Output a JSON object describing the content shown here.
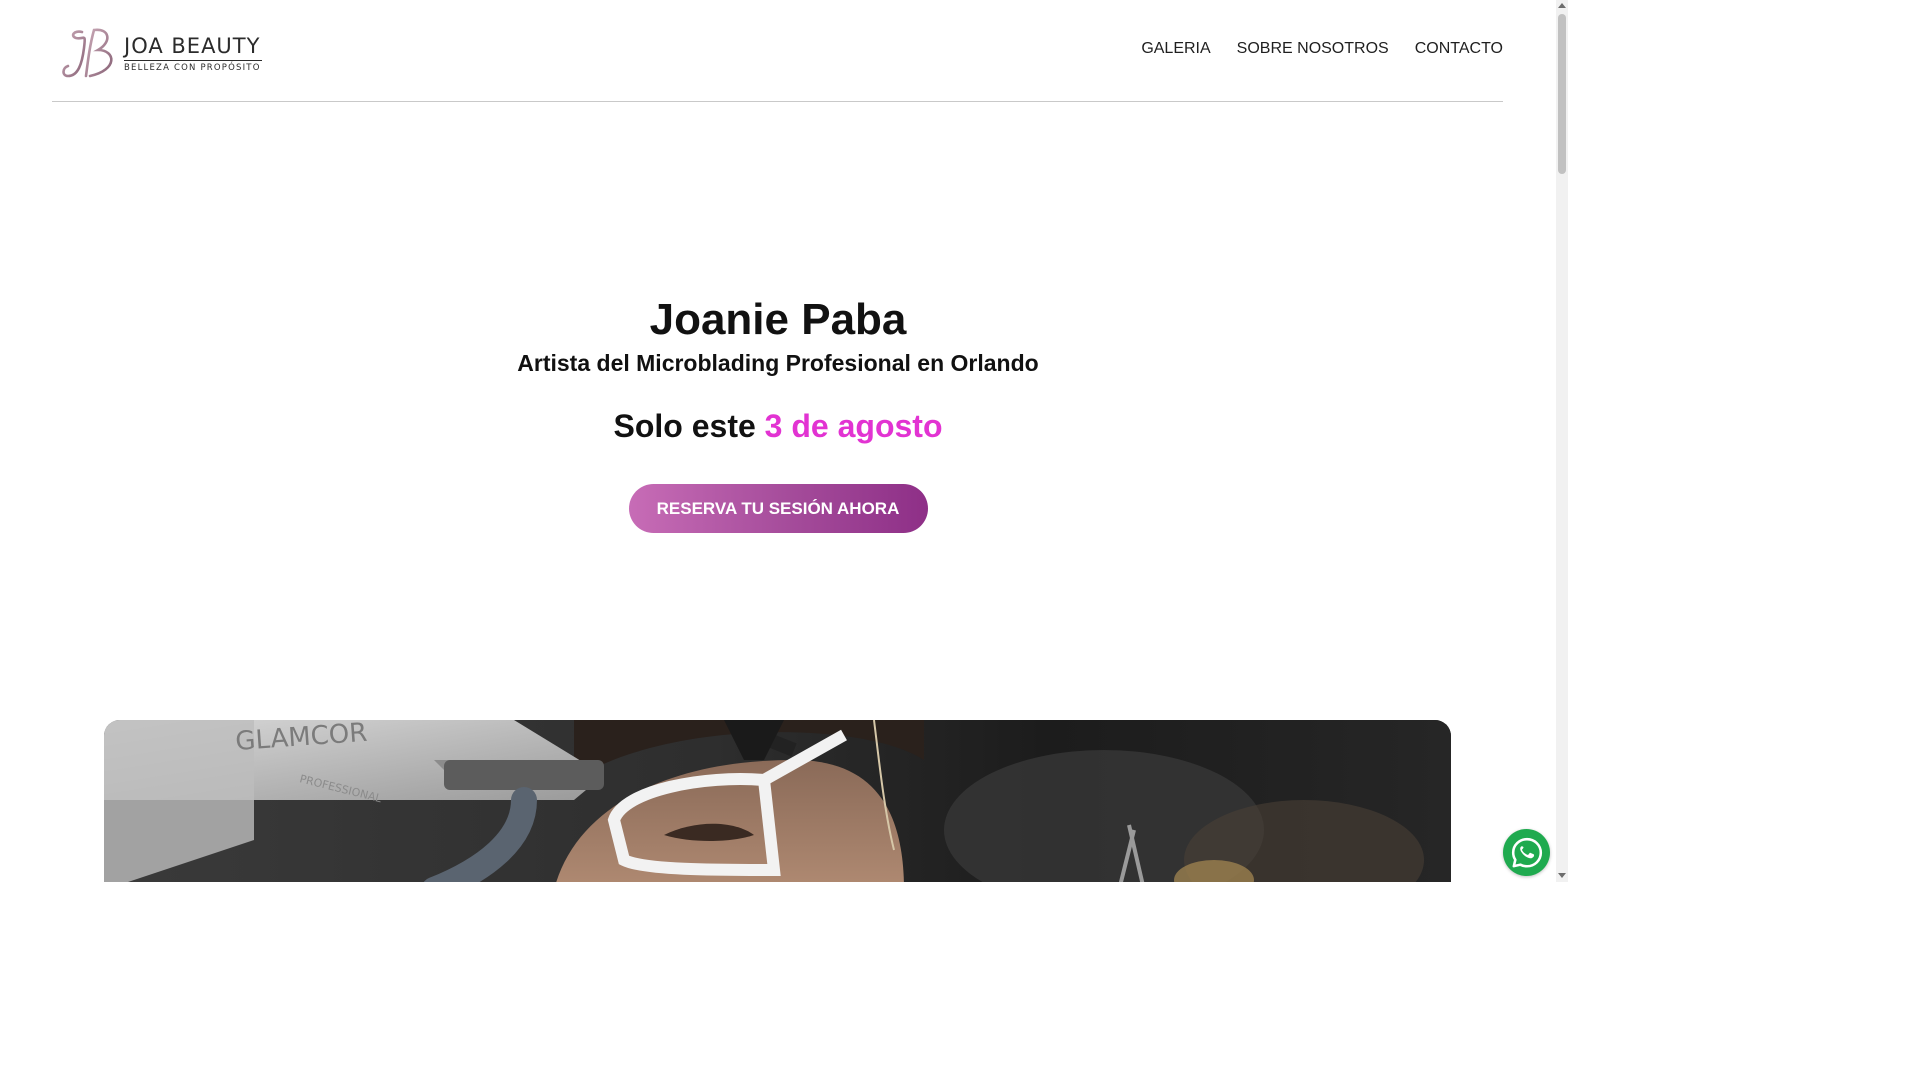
{
  "brand": {
    "title": "JOA BEAUTY",
    "tagline": "BELLEZA CON PROPÓSITO",
    "logo_icon": "jb-monogram-icon"
  },
  "nav": {
    "items": [
      {
        "label": "GALERIA"
      },
      {
        "label": "SOBRE NOSOTROS"
      },
      {
        "label": "CONTACTO"
      }
    ]
  },
  "hero": {
    "name": "Joanie Paba",
    "subtitle": "Artista del Microblading Profesional en Orlando",
    "date_prefix": "Solo este",
    "date_highlight": "3 de agosto",
    "cta_label": "RESERVA TU SESIÓN AHORA"
  },
  "photo": {
    "device_text_1": "GLAMCOR",
    "device_text_2": "PROFESSIONAL"
  },
  "floating": {
    "whatsapp_icon": "whatsapp-icon"
  },
  "colors": {
    "accent_pink": "#e233d2",
    "cta_gradient_start": "#c76cb6",
    "cta_gradient_end": "#8e2f87",
    "whatsapp_green": "#1faa4f"
  }
}
